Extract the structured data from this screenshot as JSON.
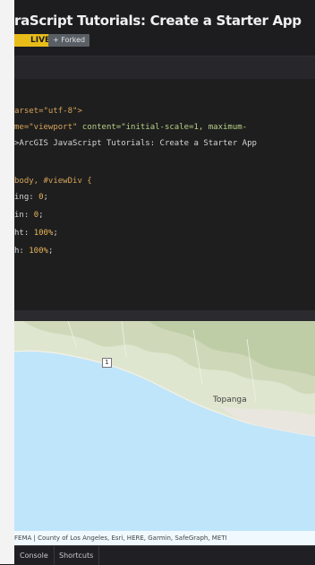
{
  "header": {
    "title": "raScript Tutorials: Create a Starter App",
    "badge": "LIVE",
    "fork_label": "+ Forked"
  },
  "editor": {
    "lines": [
      {
        "a": "arset=\"utf-8\">",
        "b": "",
        "c": ""
      },
      {
        "a": "me=\"viewport\" ",
        "b": "content=\"initial-scale=1, maximum-",
        "c": ""
      },
      {
        "a": ">ArcGIS JavaScript Tutorials: Create a Starter App",
        "b": "",
        "c": ""
      },
      {
        "a": "",
        "b": "",
        "c": ""
      },
      {
        "a": "body, #viewDiv {",
        "b": "",
        "c": ""
      },
      {
        "a": "ing: ",
        "b": "0",
        "c": ";"
      },
      {
        "a": "in: ",
        "b": "0",
        "c": ";"
      },
      {
        "a": "ht: ",
        "b": "100%",
        "c": ";"
      },
      {
        "a": "h: ",
        "b": "100%",
        "c": ";"
      }
    ]
  },
  "map": {
    "place_label": "Topanga",
    "route_number": "1",
    "attribution": "FEMA | County of Los Angeles, Esri, HERE, Garmin, SafeGraph, METI"
  },
  "bottom_bar": {
    "tab_console": "Console",
    "tab_shortcuts": "Shortcuts"
  },
  "colors": {
    "ocean": "#bfe5fb",
    "badge": "#e8bd1a",
    "editor_bg": "#1e1e1e"
  }
}
